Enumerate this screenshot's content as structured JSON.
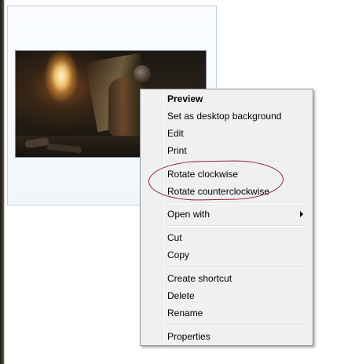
{
  "context_menu": {
    "items": [
      {
        "label": "Preview",
        "bold": true
      },
      {
        "label": "Set as desktop background"
      },
      {
        "label": "Edit"
      },
      {
        "label": "Print"
      },
      {
        "label": "Rotate clockwise"
      },
      {
        "label": "Rotate counterclockwise"
      },
      {
        "label": "Open with",
        "submenu": true
      },
      {
        "label": "Cut"
      },
      {
        "label": "Copy"
      },
      {
        "label": "Create shortcut"
      },
      {
        "label": "Delete"
      },
      {
        "label": "Rename"
      },
      {
        "label": "Properties"
      }
    ]
  },
  "colors": {
    "menu_background": "#f0f0f0",
    "menu_border": "#979797",
    "annotation": "#8e1f2f",
    "thumbnail_frame": "#c5d2e0"
  },
  "icons": {
    "submenu": "chevron-right-icon"
  }
}
